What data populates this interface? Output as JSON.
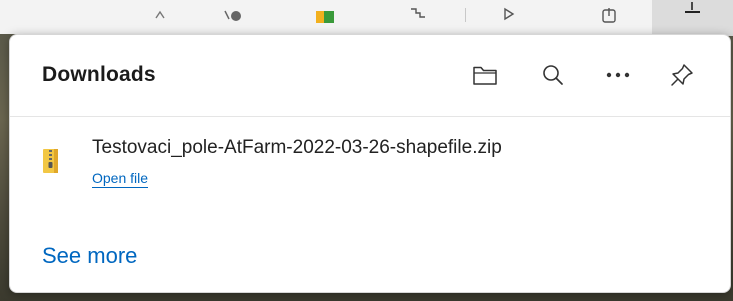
{
  "panel": {
    "title": "Downloads",
    "header_buttons": [
      {
        "icon": "folder-icon",
        "label": "Open downloads folder"
      },
      {
        "icon": "search-icon",
        "label": "Search downloads"
      },
      {
        "icon": "more-icon",
        "label": "More options"
      },
      {
        "icon": "pin-icon",
        "label": "Pin downloads"
      }
    ]
  },
  "downloads": [
    {
      "file_name": "Testovaci_pole-AtFarm-2022-03-26-shapefile.zip",
      "action_label": "Open file",
      "icon": "zip-file-icon"
    }
  ],
  "footer": {
    "see_more_label": "See more"
  },
  "colors": {
    "accent": "#0067c0",
    "text": "#1b1b1b",
    "zip_icon_yellow": "#f2c744"
  }
}
